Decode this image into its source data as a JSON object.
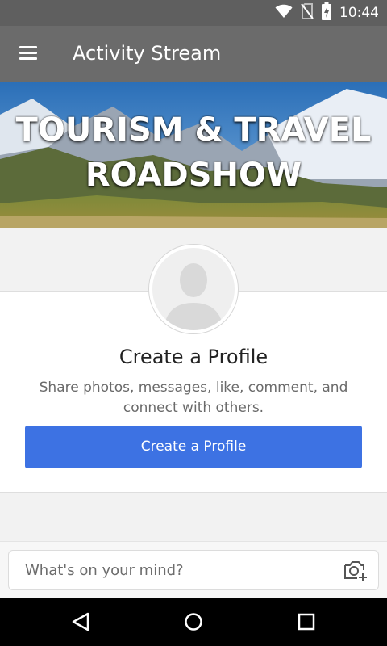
{
  "status_bar": {
    "time": "10:44",
    "icons": [
      "wifi-icon",
      "no-sim-icon",
      "battery-charging-icon"
    ]
  },
  "toolbar": {
    "title": "Activity Stream",
    "menu_icon": "hamburger-menu-icon"
  },
  "banner": {
    "line1": "TOURISM & TRAVEL",
    "line2": "ROADSHOW"
  },
  "profile_card": {
    "avatar_icon": "default-avatar-icon",
    "title": "Create a Profile",
    "description": "Share photos, messages, like, comment, and connect with others.",
    "button_label": "Create a Profile",
    "button_color": "#3d72e3"
  },
  "composer": {
    "placeholder": "What's on your mind?",
    "camera_icon": "camera-add-icon"
  },
  "nav_bar": {
    "icons": [
      "back-icon",
      "home-icon",
      "recents-icon"
    ]
  }
}
